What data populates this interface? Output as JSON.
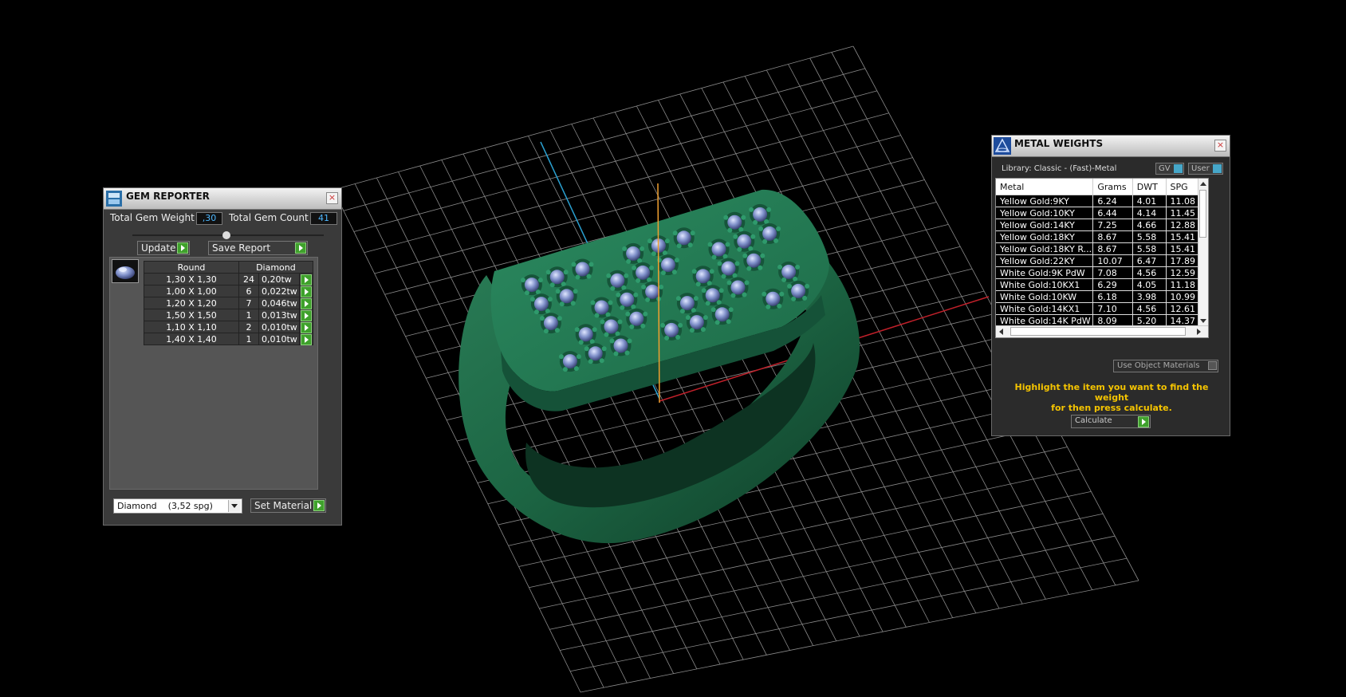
{
  "colors": {
    "accent_green": "#3fa12c",
    "field_text": "#4fb8ff",
    "hint_text": "#f5c400",
    "ring_green": "#1e6b48",
    "gem": "#7d8ec8",
    "axis_x": "#c0202a",
    "axis_y": "#f0a030",
    "axis_z": "#2aa0d0"
  },
  "gem_reporter": {
    "title": "GEM REPORTER",
    "total_weight_label": "Total Gem Weight",
    "total_weight_value": ",30",
    "total_count_label": "Total Gem Count",
    "total_count_value": "41",
    "update_label": "Update",
    "save_report_label": "Save Report",
    "table_headers": [
      "Round",
      "Diamond"
    ],
    "rows": [
      {
        "size": "1,30 X 1,30",
        "count": "24",
        "weight": "0,20tw"
      },
      {
        "size": "1,00 X 1,00",
        "count": "6",
        "weight": "0,022tw"
      },
      {
        "size": "1,20 X 1,20",
        "count": "7",
        "weight": "0,046tw"
      },
      {
        "size": "1,50 X 1,50",
        "count": "1",
        "weight": "0,013tw"
      },
      {
        "size": "1,10 X 1,10",
        "count": "2",
        "weight": "0,010tw"
      },
      {
        "size": "1,40 X 1,40",
        "count": "1",
        "weight": "0,010tw"
      }
    ],
    "material_select": "Diamond    (3,52 spg)",
    "set_material_label": "Set Material"
  },
  "metal_weights": {
    "title": "METAL WEIGHTS",
    "library_label": "Library: Classic - (Fast)-Metal",
    "gv_label": "GV",
    "user_label": "User",
    "columns": [
      "Metal",
      "Grams",
      "DWT",
      "SPG"
    ],
    "rows": [
      {
        "metal": "Yellow Gold:9KY",
        "grams": "6.24",
        "dwt": "4.01",
        "spg": "11.08"
      },
      {
        "metal": "Yellow Gold:10KY",
        "grams": "6.44",
        "dwt": "4.14",
        "spg": "11.45"
      },
      {
        "metal": "Yellow Gold:14KY",
        "grams": "7.25",
        "dwt": "4.66",
        "spg": "12.88"
      },
      {
        "metal": "Yellow Gold:18KY",
        "grams": "8.67",
        "dwt": "5.58",
        "spg": "15.41"
      },
      {
        "metal": "Yellow Gold:18KY R...",
        "grams": "8.67",
        "dwt": "5.58",
        "spg": "15.41"
      },
      {
        "metal": "Yellow Gold:22KY",
        "grams": "10.07",
        "dwt": "6.47",
        "spg": "17.89"
      },
      {
        "metal": "White Gold:9K PdW",
        "grams": "7.08",
        "dwt": "4.56",
        "spg": "12.59"
      },
      {
        "metal": "White Gold:10KX1",
        "grams": "6.29",
        "dwt": "4.05",
        "spg": "11.18"
      },
      {
        "metal": "White Gold:10KW",
        "grams": "6.18",
        "dwt": "3.98",
        "spg": "10.99"
      },
      {
        "metal": "White Gold:14KX1",
        "grams": "7.10",
        "dwt": "4.56",
        "spg": "12.61"
      },
      {
        "metal": "White Gold:14K PdW",
        "grams": "8.09",
        "dwt": "5.20",
        "spg": "14.37"
      }
    ],
    "use_object_materials_label": "Use Object Materials",
    "hint_line1": "Highlight the item you want to find the weight",
    "hint_line2": "for then press calculate.",
    "calculate_label": "Calculate"
  }
}
